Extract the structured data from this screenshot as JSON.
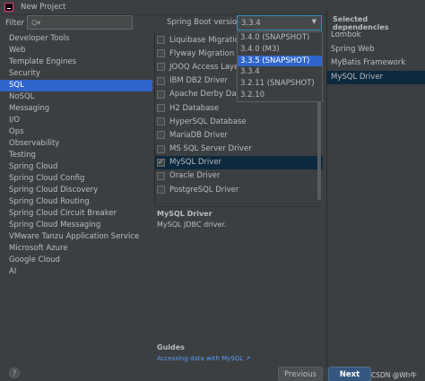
{
  "window": {
    "title": "New Project"
  },
  "filter": {
    "label": "Filter",
    "placeholder_glyph": "Q▾"
  },
  "categories": [
    "Developer Tools",
    "Web",
    "Template Engines",
    "Security",
    "SQL",
    "NoSQL",
    "Messaging",
    "I/O",
    "Ops",
    "Observability",
    "Testing",
    "Spring Cloud",
    "Spring Cloud Config",
    "Spring Cloud Discovery",
    "Spring Cloud Routing",
    "Spring Cloud Circuit Breaker",
    "Spring Cloud Messaging",
    "VMware Tanzu Application Service",
    "Microsoft Azure",
    "Google Cloud",
    "AI"
  ],
  "selected_category": "SQL",
  "spring_boot": {
    "label": "Spring Boot version",
    "value": "3.3.4",
    "options": [
      "3.4.0 (SNAPSHOT)",
      "3.4.0 (M3)",
      "3.3.5 (SNAPSHOT)",
      "3.3.4",
      "3.2.11 (SNAPSHOT)",
      "3.2.10"
    ],
    "highlighted_option": "3.3.5 (SNAPSHOT)"
  },
  "dependencies": [
    {
      "label": "Liquibase Migration",
      "checked": false
    },
    {
      "label": "Flyway Migration",
      "checked": false
    },
    {
      "label": "JOOQ Access Layer",
      "checked": false
    },
    {
      "label": "IBM DB2 Driver",
      "checked": false
    },
    {
      "label": "Apache Derby Database",
      "checked": false
    },
    {
      "label": "H2 Database",
      "checked": false
    },
    {
      "label": "HyperSQL Database",
      "checked": false
    },
    {
      "label": "MariaDB Driver",
      "checked": false
    },
    {
      "label": "MS SQL Server Driver",
      "checked": false
    },
    {
      "label": "MySQL Driver",
      "checked": true
    },
    {
      "label": "Oracle Driver",
      "checked": false
    },
    {
      "label": "PostgreSQL Driver",
      "checked": false
    }
  ],
  "description": {
    "title": "MySQL Driver",
    "text": "MySQL JDBC driver.",
    "guides_title": "Guides",
    "guides_link": "Accessing data with MySQL ↗"
  },
  "selected_dependencies": {
    "header": "Selected dependencies",
    "items": [
      "Lombok",
      "Spring Web",
      "MyBatis Framework",
      "MySQL Driver"
    ],
    "active_item": "MySQL Driver"
  },
  "buttons": {
    "help": "?",
    "previous": "Previous",
    "next": "Next"
  },
  "watermark": "CSDN @Wh牛"
}
